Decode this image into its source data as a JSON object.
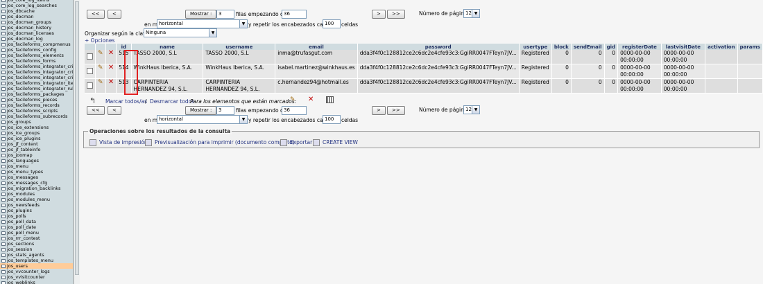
{
  "sidebar": {
    "items": [
      "jos_core_log_items",
      "jos_core_log_searches",
      "jos_dbcache",
      "jos_docman",
      "jos_docman_groups",
      "jos_docman_history",
      "jos_docman_licenses",
      "jos_docman_log",
      "jos_facileforms_compmenus",
      "jos_facileforms_config",
      "jos_facileforms_elements",
      "jos_facileforms_forms",
      "jos_facileforms_integrator_criteria",
      "jos_facileforms_integrator_criteria",
      "jos_facileforms_integrator_criteria",
      "jos_facileforms_integrator_items",
      "jos_facileforms_integrator_rules",
      "jos_facileforms_packages",
      "jos_facileforms_pieces",
      "jos_facileforms_records",
      "jos_facileforms_scripts",
      "jos_facileforms_subrecords",
      "jos_groups",
      "jos_ice_extensions",
      "jos_ice_groups",
      "jos_ice_plugins",
      "jos_jf_content",
      "jos_jf_tableinfo",
      "jos_joomap",
      "jos_languages",
      "jos_menu",
      "jos_menu_types",
      "jos_messages",
      "jos_messages_cfg",
      "jos_migration_backlinks",
      "jos_modules",
      "jos_modules_menu",
      "jos_newsfeeds",
      "jos_plugins",
      "jos_polls",
      "jos_poll_data",
      "jos_poll_date",
      "jos_poll_menu",
      "jos_rrr_contest",
      "jos_sections",
      "jos_session",
      "jos_stats_agents",
      "jos_templates_menu",
      "jos_users",
      "jos_vvcounter_logs",
      "jos_vvisitcounter",
      "jos_weblinks"
    ],
    "active": "jos_users"
  },
  "nav_top": {
    "first": "<<",
    "prev": "<",
    "show": "Mostrar :",
    "rows": "3",
    "rows_label": "filas empezando de",
    "start": "36",
    "next": ">",
    "last": ">>",
    "page_label": "Número de página:",
    "page": "12",
    "mode_label": "en modo",
    "mode": "horizontal",
    "repeat_label": "y repetir los encabezados cada",
    "repeat": "100",
    "cells_label": "celdas"
  },
  "sort": {
    "label": "Organizar según la clave:",
    "value": "Ninguna"
  },
  "options_link": "+ Opciones",
  "table": {
    "columns": [
      "id",
      "name",
      "username",
      "email",
      "password",
      "usertype",
      "block",
      "sendEmail",
      "gid",
      "registerDate",
      "lastvisitDate",
      "activation",
      "params"
    ],
    "rows": [
      {
        "id": "515",
        "name": "TASSO 2000, S.L",
        "username": "TASSO 2000, S.L",
        "email": "inma@trufasgut.com",
        "password": "dda3f4f0c128812ce2c6dc2e4cfe93c3:GgiRR0047FTeyn7JV...",
        "usertype": "Registered",
        "block": "0",
        "sendEmail": "0",
        "gid": "0",
        "registerDate": "0000-00-00 00:00:00",
        "lastvisitDate": "0000-00-00 00:00:00",
        "activation": "",
        "params": ""
      },
      {
        "id": "514",
        "name": "WinkHaus Iberica, S.A.",
        "username": "WinkHaus Iberica, S.A.",
        "email": "isabel.martinez@winkhaus.es",
        "password": "dda3f4f0c128812ce2c6dc2e4cfe93c3:GgiRR0047FTeyn7JV...",
        "usertype": "Registered",
        "block": "0",
        "sendEmail": "0",
        "gid": "0",
        "registerDate": "0000-00-00 00:00:00",
        "lastvisitDate": "0000-00-00 00:00:00",
        "activation": "",
        "params": ""
      },
      {
        "id": "513",
        "name": "CARPINTERIA HERNANDEZ 94, S.L.",
        "username": "CARPINTERIA HERNANDEZ 94, S.L.",
        "email": "c.hernandez94@hotmail.es",
        "password": "dda3f4f0c128812ce2c6dc2e4cfe93c3:GgiRR0047FTeyn7JV...",
        "usertype": "Registered",
        "block": "0",
        "sendEmail": "0",
        "gid": "0",
        "registerDate": "0000-00-00 00:00:00",
        "lastvisitDate": "0000-00-00 00:00:00",
        "activation": "",
        "params": ""
      }
    ]
  },
  "mark": {
    "check_all": "Marcar todos/as",
    "sep": "/",
    "uncheck_all": "Desmarcar todos",
    "with_selected": "Para los elementos que están marcados:"
  },
  "nav_bottom": {
    "first": "<<",
    "prev": "<",
    "show": "Mostrar :",
    "rows": "3",
    "rows_label": "filas empezando de",
    "start": "36",
    "next": ">",
    "last": ">>",
    "page_label": "Número de página:",
    "page": "12",
    "mode_label": "en modo",
    "mode": "horizontal",
    "repeat_label": "y repetir los encabezados cada",
    "repeat": "100",
    "cells_label": "celdas"
  },
  "operations": {
    "legend": "Operaciones sobre los resultados de la consulta",
    "print_view": "Vista de impresión",
    "print_preview": "Previsualización para imprimir (documento completo)",
    "export": "Exportar",
    "create_view": "CREATE VIEW"
  },
  "colors": {
    "header_bg": "#d0dce0",
    "active_table": "#ffcc99",
    "highlight_box": "#e02020",
    "link": "#203080"
  }
}
